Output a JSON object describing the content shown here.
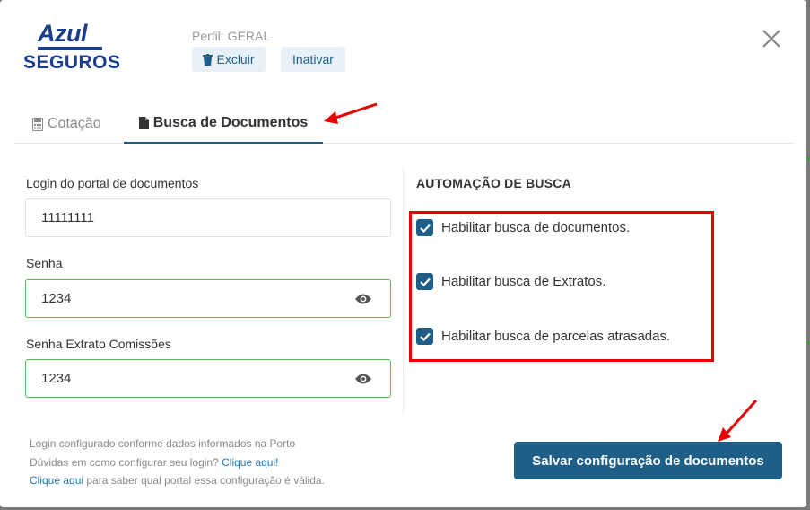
{
  "logo": {
    "top": "Azul",
    "bottom": "SEGUROS"
  },
  "profile": {
    "text": "Perfil: GERAL"
  },
  "actions": {
    "excluir": "Excluir",
    "inativar": "Inativar"
  },
  "tabs": [
    {
      "label": "Cotação",
      "icon": "calculator-icon",
      "active": false
    },
    {
      "label": "Busca de Documentos",
      "icon": "document-icon",
      "active": true
    }
  ],
  "form": {
    "login": {
      "label": "Login do portal de documentos",
      "value": "11111111"
    },
    "senha": {
      "label": "Senha",
      "value": "1234"
    },
    "senha_extrato": {
      "label": "Senha Extrato Comissões",
      "value": "1234"
    }
  },
  "automation": {
    "title": "AUTOMAÇÃO DE BUSCA",
    "options": [
      {
        "label": "Habilitar busca de documentos.",
        "checked": true
      },
      {
        "label": "Habilitar busca de Extratos.",
        "checked": true
      },
      {
        "label": "Habilitar busca de parcelas atrasadas.",
        "checked": true
      }
    ]
  },
  "footer": {
    "line1": "Login configurado conforme dados informados na Porto",
    "line2_text": "Dúvidas em como configurar seu login? ",
    "line2_link": "Clique aqui!",
    "line3_link": "Clique aqui",
    "line3_text": " para saber qual portal essa configuração é válida."
  },
  "save_button": "Salvar configuração de documentos",
  "colors": {
    "primary": "#1f5f87",
    "highlight": "#e60000",
    "valid": "#5cb85c",
    "link": "#1f7ab8"
  }
}
